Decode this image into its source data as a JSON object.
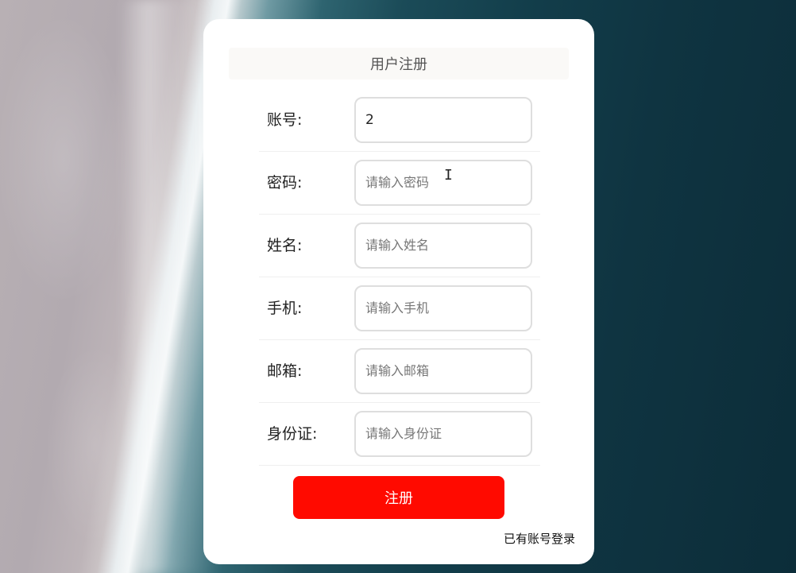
{
  "form": {
    "title": "用户注册",
    "fields": [
      {
        "label": "账号:",
        "value": "2",
        "placeholder": ""
      },
      {
        "label": "密码:",
        "value": "",
        "placeholder": "请输入密码"
      },
      {
        "label": "姓名:",
        "value": "",
        "placeholder": "请输入姓名"
      },
      {
        "label": "手机:",
        "value": "",
        "placeholder": "请输入手机"
      },
      {
        "label": "邮箱:",
        "value": "",
        "placeholder": "请输入邮箱"
      },
      {
        "label": "身份证:",
        "value": "",
        "placeholder": "请输入身份证"
      }
    ],
    "submit_label": "注册",
    "login_link": "已有账号登录"
  },
  "colors": {
    "submit_bg": "#ff0a00",
    "card_bg": "#ffffff"
  },
  "icons": {
    "cursor": "text-cursor-icon"
  }
}
